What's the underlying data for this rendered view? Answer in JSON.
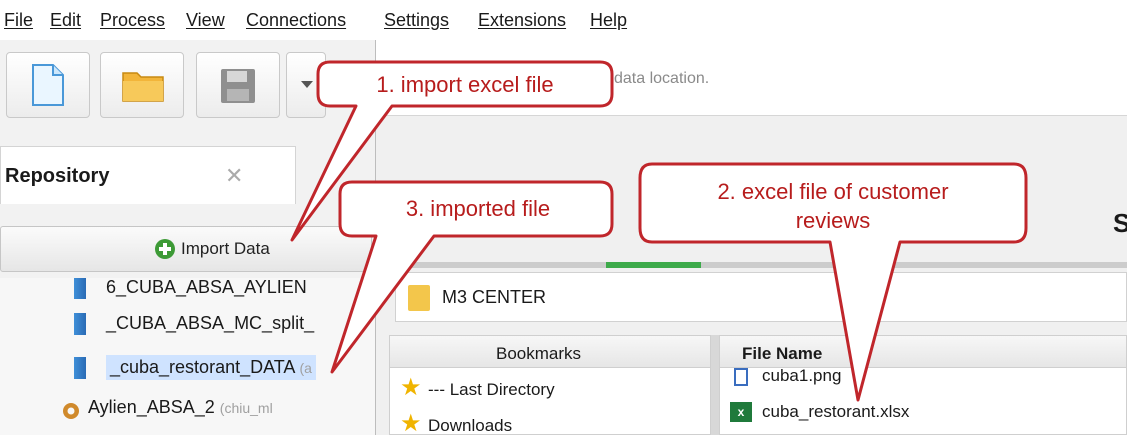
{
  "menu": {
    "items": [
      "File",
      "Edit",
      "Process",
      "View",
      "Connections",
      "Settings",
      "Extensions",
      "Help"
    ]
  },
  "toolbar": {
    "new_icon": "new-document-icon",
    "open_icon": "folder-icon",
    "save_icon": "floppy-disk-icon",
    "dropdown_icon": "chevron-down-icon"
  },
  "repository": {
    "title": "Repository",
    "close": "✕",
    "import_label": "Import Data",
    "items": [
      {
        "label": "6_CUBA_ABSA_AYLIEN",
        "suffix": "",
        "icon": "data-icon"
      },
      {
        "label": "_CUBA_ABSA_MC_split_",
        "suffix": "",
        "icon": "data-icon"
      },
      {
        "label": "_cuba_restorant_DATA",
        "suffix": "(a",
        "icon": "data-icon",
        "selected": true
      },
      {
        "label": "Aylien_ABSA_2",
        "suffix": "(chiu_ml",
        "icon": "gear-icon"
      }
    ]
  },
  "dialog": {
    "hint": "data location.",
    "corner_letter": "S",
    "path": "M3 CENTER",
    "bookmarks_header": "Bookmarks",
    "bookmarks": [
      "--- Last Directory",
      "Downloads"
    ],
    "filename_header": "File Name",
    "files": [
      {
        "name": "cuba1.png",
        "type": "png"
      },
      {
        "name": "cuba_restorant.xlsx",
        "type": "xlsx"
      }
    ],
    "progress_step": 1
  },
  "callouts": [
    {
      "id": "callout-1",
      "text": "1. import excel file"
    },
    {
      "id": "callout-2",
      "lines": [
        "2. excel file of customer",
        "reviews"
      ]
    },
    {
      "id": "callout-3",
      "text": "3. imported file"
    }
  ],
  "colors": {
    "callout_border": "#c0262b",
    "callout_text": "#b71c1c",
    "progress": "#3daa4a",
    "selection": "#cfe3ff"
  }
}
